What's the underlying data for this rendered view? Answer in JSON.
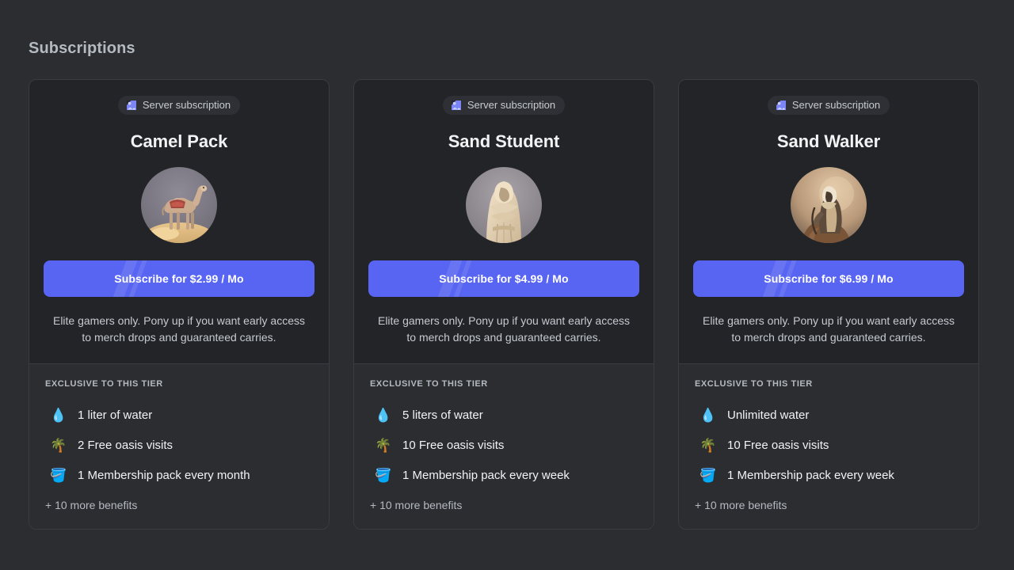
{
  "header": {
    "title": "Subscriptions"
  },
  "theme": {
    "page_background": "#2b2d31",
    "card_background": "#232428",
    "card_border": "#3a3c41",
    "benefits_background": "#2b2d31",
    "accent": "#5865f2",
    "badge_pill_background": "#2e3035",
    "title_color": "#b5bac1",
    "tier_name_color": "#f2f3f5",
    "body_text_color": "#c5cad1"
  },
  "badge": {
    "icon": "server-subscription-icon",
    "label": "Server subscription"
  },
  "benefits_heading": "EXCLUSIVE TO THIS TIER",
  "cards": [
    {
      "badge_label": "Server subscription",
      "tier_name": "Camel Pack",
      "avatar": "camel-avatar",
      "subscribe_label": "Subscribe for $2.99 / Mo",
      "price": "$2.99",
      "period": "Mo",
      "description": "Elite gamers only. Pony up if you want early access to merch drops and guaranteed carries.",
      "benefits_heading": "EXCLUSIVE TO THIS TIER",
      "benefits": [
        {
          "emoji": "💧",
          "icon": "water-droplet-icon",
          "text": "1 liter of water"
        },
        {
          "emoji": "🌴",
          "icon": "palm-tree-icon",
          "text": "2 Free oasis visits"
        },
        {
          "emoji": "🪣",
          "icon": "bucket-icon",
          "text": "1 Membership pack every month"
        }
      ],
      "more_benefits": "+ 10 more benefits"
    },
    {
      "badge_label": "Server subscription",
      "tier_name": "Sand Student",
      "avatar": "hooded-figure-avatar",
      "subscribe_label": "Subscribe for $4.99 / Mo",
      "price": "$4.99",
      "period": "Mo",
      "description": "Elite gamers only. Pony up if you want early access to merch drops and guaranteed carries.",
      "benefits_heading": "EXCLUSIVE TO THIS TIER",
      "benefits": [
        {
          "emoji": "💧",
          "icon": "water-droplet-icon",
          "text": "5 liters of water"
        },
        {
          "emoji": "🌴",
          "icon": "palm-tree-icon",
          "text": "10 Free oasis visits"
        },
        {
          "emoji": "🪣",
          "icon": "bucket-icon",
          "text": "1 Membership pack every week"
        }
      ],
      "more_benefits": "+ 10 more benefits"
    },
    {
      "badge_label": "Server subscription",
      "tier_name": "Sand Walker",
      "avatar": "desert-rider-avatar",
      "subscribe_label": "Subscribe for $6.99 / Mo",
      "price": "$6.99",
      "period": "Mo",
      "description": "Elite gamers only. Pony up if you want early access to merch drops and guaranteed carries.",
      "benefits_heading": "EXCLUSIVE TO THIS TIER",
      "benefits": [
        {
          "emoji": "💧",
          "icon": "water-droplet-icon",
          "text": "Unlimited water"
        },
        {
          "emoji": "🌴",
          "icon": "palm-tree-icon",
          "text": "10 Free oasis visits"
        },
        {
          "emoji": "🪣",
          "icon": "bucket-icon",
          "text": "1 Membership pack every week"
        }
      ],
      "more_benefits": "+ 10 more benefits"
    }
  ]
}
